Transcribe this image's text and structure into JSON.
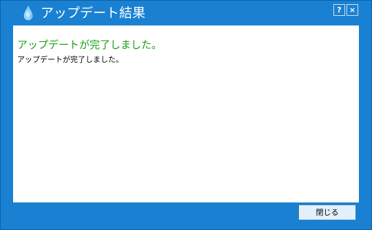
{
  "window": {
    "title": "アップデート結果",
    "help_label": "?",
    "close_label": "×"
  },
  "content": {
    "heading": "アップデートが完了しました。",
    "message": "アップデートが完了しました。"
  },
  "footer": {
    "close_button_label": "閉じる"
  },
  "icons": {
    "app": "water-drop-icon",
    "help": "help-icon",
    "close": "close-icon"
  },
  "colors": {
    "frame": "#1a81d2",
    "heading_text": "#18a018",
    "button_bg": "#e1f0fb"
  }
}
